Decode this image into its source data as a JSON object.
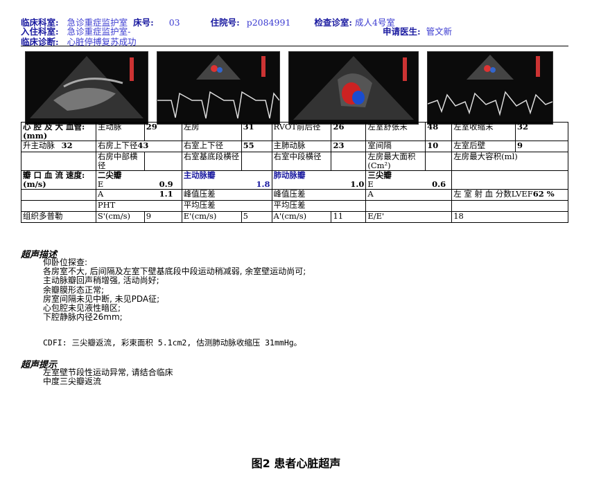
{
  "header": {
    "dept_label": "临床科室:",
    "dept_value": "急诊重症监护室",
    "bed_label": "床号:",
    "bed_value": "03",
    "admit_label": "住院号:",
    "admit_value": "p2084991",
    "exam_room_label": "检查诊室:",
    "exam_room_value": "成人4号室",
    "ward_label": "入住科室:",
    "ward_value": "急诊重症监护室-",
    "doctor_label": "申请医生:",
    "doctor_value": "管文新",
    "diag_label": "临床诊断:",
    "diag_value": "心脏停搏复苏成功"
  },
  "table": {
    "r1": [
      "心 腔 及 大 血管:(mm)",
      "主动脉",
      "29",
      "左房",
      "31",
      "RVOT前后径",
      "26",
      "左室舒张末",
      "48",
      "左室收缩末",
      "32"
    ],
    "r2": [
      "升主动脉",
      "32",
      "右房上下径",
      "43",
      "右室上下径",
      "55",
      "主肺动脉",
      "23",
      "室间隔",
      "10",
      "左室后壁",
      "9"
    ],
    "r3": [
      "右房中部横径",
      "右室基底段横径",
      "右室中段横径",
      "左房最大面积(Cm²)",
      "左房最大容积(ml)"
    ],
    "r4": [
      "瓣 口 血 流 速度:(m/s)",
      "二尖瓣",
      "E",
      "0.9",
      "主动脉瓣",
      "1.8",
      "肺动脉瓣",
      "1.0",
      "三尖瓣",
      "E",
      "0.6"
    ],
    "r5": [
      "A",
      "1.1",
      "峰值压差",
      "峰值压差",
      "A",
      "左 室 射 血 分数LVEF",
      "62 %"
    ],
    "r6": [
      "PHT",
      "平均压差",
      "平均压差"
    ],
    "r7": [
      "组织多普勒",
      "S'(cm/s)",
      "9",
      "E'(cm/s)",
      "5",
      "A'(cm/s)",
      "11",
      "E/E'",
      "18"
    ]
  },
  "description": {
    "title": "超声描述",
    "lines": [
      "仰卧位探查:",
      "各房室不大, 后间隔及左室下壁基底段中段运动稍减弱, 余室壁运动尚可;",
      "主动脉瓣回声稍增强, 活动尚好;",
      "余瓣膜形态正常;",
      "房室间隔未见中断, 未见PDA征;",
      "心包腔未见液性暗区;",
      "下腔静脉内径26mm;"
    ],
    "cdfi": "CDFI: 三尖瓣返流, 彩束面积 5.1cm2, 估测肺动脉收缩压 31mmHg。"
  },
  "conclusion": {
    "title": "超声提示",
    "lines": [
      "左室壁节段性运动异常, 请结合临床",
      "中度三尖瓣返流"
    ]
  },
  "caption": "图2 患者心脏超声"
}
